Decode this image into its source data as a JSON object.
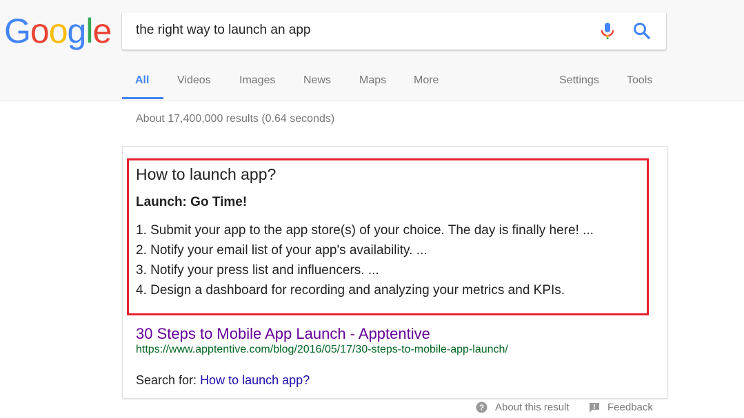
{
  "logo": {
    "letters": [
      "G",
      "o",
      "o",
      "g",
      "l",
      "e"
    ],
    "colors": [
      "#4285f4",
      "#ea4335",
      "#fbbc05",
      "#4285f4",
      "#34a853",
      "#ea4335"
    ]
  },
  "search": {
    "query": "the right way to launch an app",
    "mic_icon": "microphone-icon",
    "search_icon": "magnifier-icon"
  },
  "tabs": {
    "all": "All",
    "videos": "Videos",
    "images": "Images",
    "news": "News",
    "maps": "Maps",
    "more": "More",
    "settings": "Settings",
    "tools": "Tools"
  },
  "results_stats": "About 17,400,000 results (0.64 seconds)",
  "snippet": {
    "question": "How to launch app?",
    "heading": "Launch: Go Time!",
    "steps": [
      "1. Submit your app to the app store(s) of your choice. The day is finally here! ...",
      "2. Notify your email list of your app's availability. ...",
      "3. Notify your press list and influencers. ...",
      "4. Design a dashboard for recording and analyzing your metrics and KPIs."
    ],
    "result_title": "30 Steps to Mobile App Launch - Apptentive",
    "result_url": "https://www.apptentive.com/blog/2016/05/17/30-steps-to-mobile-app-launch/",
    "search_for_label": "Search for:",
    "search_for_link": "How to launch app?"
  },
  "footer": {
    "about": "About this result",
    "feedback": "Feedback"
  },
  "colors": {
    "highlight_border": "#e5202e",
    "link_visited": "#660099",
    "url_green": "#006621",
    "link_blue": "#1a0dab",
    "tab_active": "#4285f4"
  }
}
